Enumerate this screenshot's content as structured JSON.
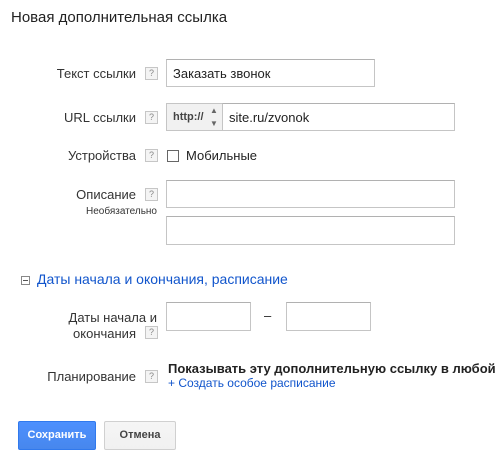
{
  "page": {
    "title": "Новая дополнительная ссылка"
  },
  "form": {
    "link_text": {
      "label": "Текст ссылки",
      "value": "Заказать звонок"
    },
    "url": {
      "label": "URL ссылки",
      "protocol": "http://",
      "value": "site.ru/zvonok"
    },
    "devices": {
      "label": "Устройства",
      "checkbox_label": "Мобильные",
      "checked": false
    },
    "description": {
      "label": "Описание",
      "sublabel": "Необязательно",
      "line1": "",
      "line2": ""
    },
    "schedule_section": {
      "toggle_title": "Даты начала и окончания, расписание"
    },
    "dates": {
      "label_line1": "Даты начала и",
      "label_line2": "окончания",
      "separator": "–",
      "start": "",
      "end": ""
    },
    "planning": {
      "label": "Планирование",
      "text": "Показывать эту дополнительную ссылку в любой",
      "link": "+ Создать особое расписание"
    }
  },
  "help_glyph": "?",
  "buttons": {
    "save": "Сохранить",
    "cancel": "Отмена"
  },
  "colors": {
    "primary": "#4d90fe",
    "link": "#1155cc"
  }
}
